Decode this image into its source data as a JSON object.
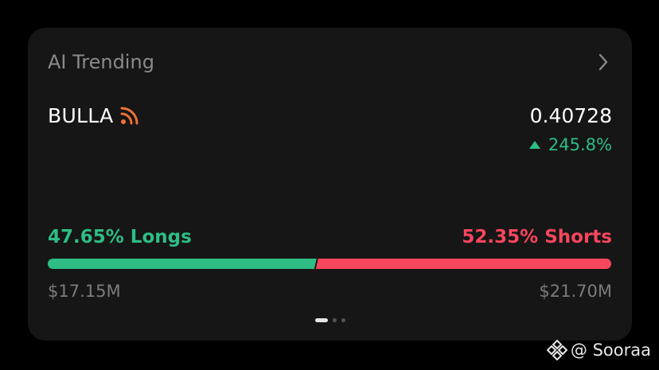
{
  "card": {
    "title": "AI Trending",
    "chevron_icon": "chevron-right-icon"
  },
  "ticker": {
    "symbol": "BULLA",
    "feed_icon": "rss-feed-icon",
    "price": "0.40728",
    "change": "245.8%",
    "change_direction": "up"
  },
  "ratio": {
    "longs_label": "47.65% Longs",
    "shorts_label": "52.35% Shorts",
    "longs_fraction": 0.4765,
    "shorts_fraction": 0.5235,
    "longs_amount": "$17.15M",
    "shorts_amount": "$21.70M"
  },
  "pager": {
    "total": 3,
    "active_index": 0
  },
  "watermark": {
    "icon": "binance-logo-icon",
    "text": "@ Sooraa"
  },
  "colors": {
    "background": "#000000",
    "card": "#161616",
    "positive": "#2ebd85",
    "negative": "#f6465d",
    "muted_text": "#8a8a8a",
    "feed_icon": "#f0703a"
  }
}
